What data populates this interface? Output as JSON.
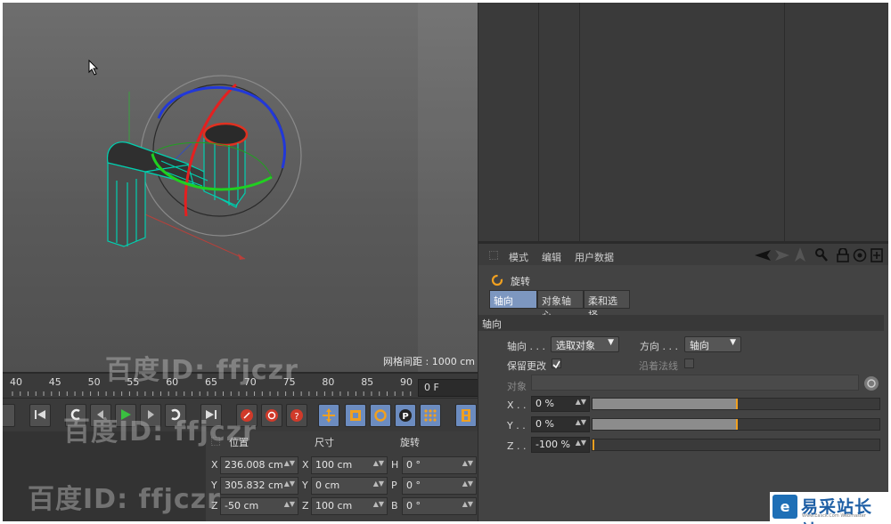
{
  "viewport": {
    "grid_spacing_label": "网格间距 : 1000 cm"
  },
  "timeline": {
    "ticks": [
      "40",
      "45",
      "50",
      "55",
      "60",
      "65",
      "70",
      "75",
      "80",
      "85",
      "90"
    ],
    "frame_value": "0 F"
  },
  "transport": {
    "icons": [
      "go-to-start-icon",
      "previous-key-icon",
      "previous-frame-icon",
      "play-icon",
      "next-frame-icon",
      "next-key-icon",
      "go-to-end-icon",
      "record-icon",
      "autokey-icon",
      "keyframe-selection-icon",
      "move-key-icon",
      "scale-key-icon",
      "rotate-key-icon",
      "parameter-key-icon",
      "point-level-icon",
      "film-icon"
    ]
  },
  "coordinates": {
    "headers": {
      "position": "位置",
      "size": "尺寸",
      "rotation": "旋转"
    },
    "rows": [
      {
        "pos_axis": "X",
        "pos": "236.008 cm",
        "size_axis": "X",
        "size": "100 cm",
        "rot_axis": "H",
        "rot": "0 °"
      },
      {
        "pos_axis": "Y",
        "pos": "305.832 cm",
        "size_axis": "Y",
        "size": "0 cm",
        "rot_axis": "P",
        "rot": "0 °"
      },
      {
        "pos_axis": "Z",
        "pos": "-50 cm",
        "size_axis": "Z",
        "size": "100 cm",
        "rot_axis": "B",
        "rot": "0 °"
      }
    ]
  },
  "attributes": {
    "menu": [
      "模式",
      "编辑",
      "用户数据"
    ],
    "title": "旋转",
    "tabs": [
      "轴向",
      "对象轴心",
      "柔和选择"
    ],
    "section": "轴向",
    "axis_label": "轴向 . . .",
    "axis_value": "选取对象",
    "direction_label": "方向 . . .",
    "direction_value": "轴向",
    "keep_changes_label": "保留更改",
    "along_normal_label": "沿着法线",
    "object_label": "对象",
    "x_label": "X . .",
    "x_value": "0 %",
    "x_level": 0.5,
    "y_label": "Y . .",
    "y_value": "0 %",
    "y_level": 0.5,
    "z_label": "Z . .",
    "z_value": "-100 %",
    "z_level": 0.0
  },
  "watermarks": {
    "baidu_1": "百度ID: ffjczr",
    "baidu_2": "百度ID: ffjczr",
    "baidu_3": "百度ID: ffjczr",
    "site_name": "易采站长站",
    "site_sub": "Www.Easck.Com Webmaster"
  }
}
